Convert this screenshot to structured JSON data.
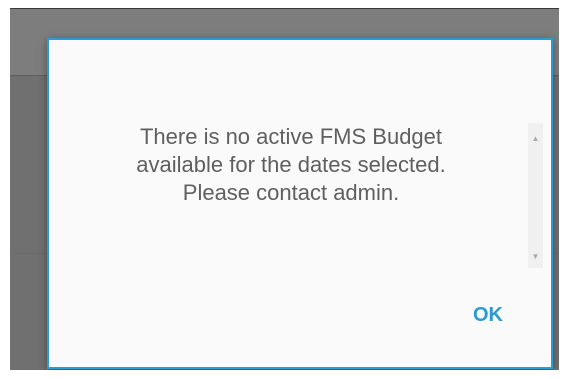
{
  "dialog": {
    "message_lines": [
      "There is no active FMS Budget",
      "available for the dates selected.",
      "Please contact admin."
    ],
    "ok_label": "OK",
    "accent_color": "#2b9bd1"
  },
  "icons": {
    "scroll_up": "▲",
    "scroll_down": "▼"
  }
}
